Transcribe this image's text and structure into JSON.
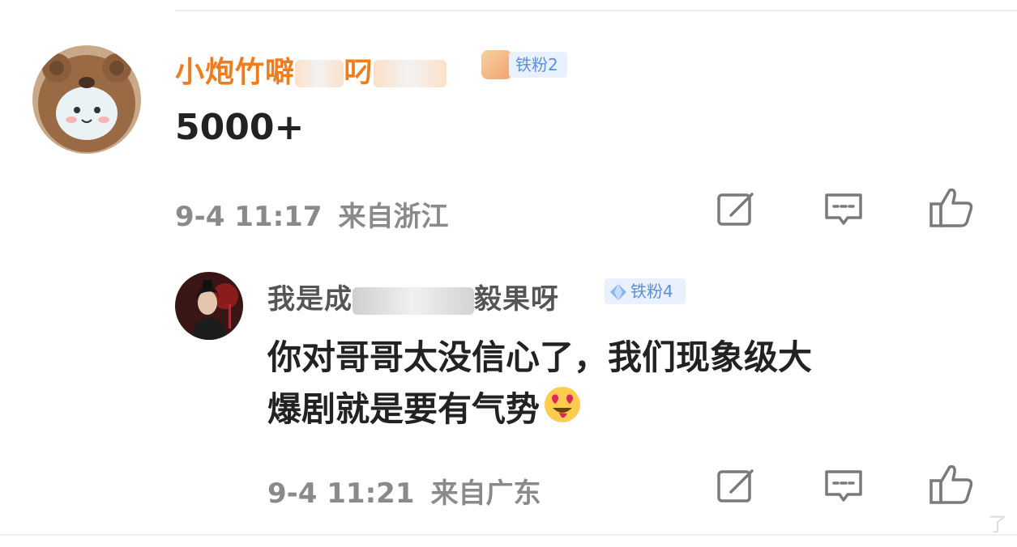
{
  "comment": {
    "username_visible": "小炮竹噼",
    "username_visible_tail": "叼",
    "badge": "铁粉2",
    "content": "5000+",
    "time": "9-4 11:17",
    "location": "来自浙江"
  },
  "reply": {
    "username_prefix": "我是成",
    "username_suffix": "毅果呀",
    "badge": "铁粉4",
    "content_line1": "你对哥哥太没信心了，我们现象级大",
    "content_line2": "爆剧就是要有气势",
    "emoji": "😍",
    "time": "9-4 11:21",
    "location": "来自广东"
  },
  "watermark": "了",
  "colors": {
    "username_orange": "#ef7d1e",
    "badge_blue": "#5b8fd6",
    "meta_gray": "#8a8a8a",
    "icon_gray": "#7a7a7a"
  },
  "icons": {
    "actions": [
      "share-edit-icon",
      "comment-icon",
      "like-icon"
    ],
    "badge_diamond": "diamond-icon"
  }
}
